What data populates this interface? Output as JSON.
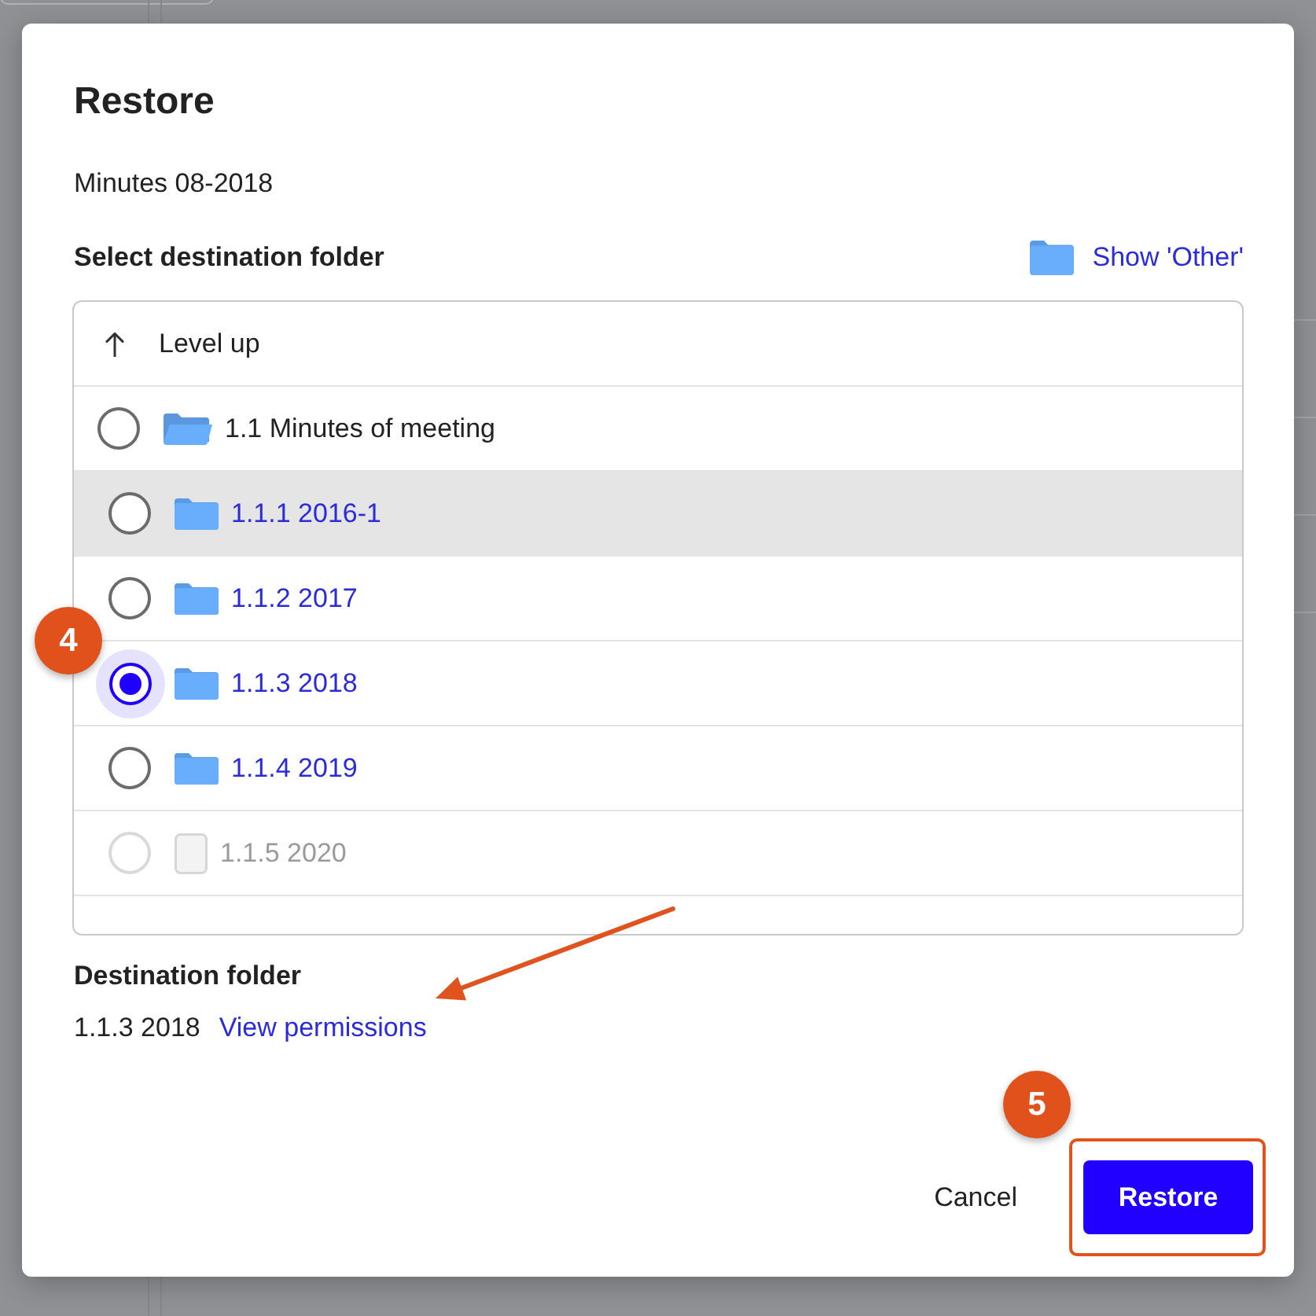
{
  "dialog": {
    "title": "Restore",
    "item_name": "Minutes 08-2018"
  },
  "picker": {
    "label": "Select destination folder",
    "show_other": "Show 'Other'",
    "level_up": "Level up"
  },
  "folders": [
    {
      "kind": "parent",
      "label": "1.1 Minutes of meeting",
      "selected": false,
      "hovered": false,
      "disabled": false,
      "children": [
        {
          "kind": "folder",
          "label": "1.1.1 2016-1",
          "selected": false,
          "hovered": true,
          "disabled": false
        },
        {
          "kind": "folder",
          "label": "1.1.2 2017",
          "selected": false,
          "hovered": false,
          "disabled": false
        },
        {
          "kind": "folder",
          "label": "1.1.3 2018",
          "selected": true,
          "hovered": false,
          "disabled": false,
          "step_badge": "4"
        },
        {
          "kind": "folder",
          "label": "1.1.4 2019",
          "selected": false,
          "hovered": false,
          "disabled": false
        },
        {
          "kind": "file",
          "label": "1.1.5 2020",
          "selected": false,
          "hovered": false,
          "disabled": true
        }
      ]
    }
  ],
  "destination": {
    "label": "Destination folder",
    "value": "1.1.3 2018",
    "permissions_link": "View permissions",
    "annotation_arrow": true
  },
  "buttons": [
    {
      "kind": "secondary",
      "label": "Cancel"
    },
    {
      "kind": "primary",
      "label": "Restore",
      "step_badge": "5",
      "highlighted": true
    }
  ]
}
